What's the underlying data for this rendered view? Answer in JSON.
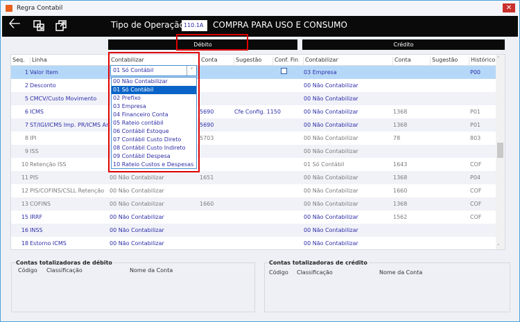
{
  "window": {
    "title": "Regra Contabil",
    "close": "✕"
  },
  "toolbar": {
    "tipo_label": "Tipo de Operação",
    "tipo_value": "110.1A",
    "tipo_desc": "COMPRA PARA USO E CONSUMO"
  },
  "bands": {
    "debito": "Débito",
    "credito": "Crédito"
  },
  "headers": {
    "seq": "Seq.",
    "linha": "Linha",
    "d_contabilizar": "Contabilizar",
    "d_conta": "Conta",
    "d_sugestao": "Sugestão",
    "conf_fin": "Conf. Fin",
    "c_contabilizar": "Contabilizar",
    "c_conta": "Conta",
    "c_sugestao": "Sugestão",
    "historico": "Histórico"
  },
  "rows": [
    {
      "seq": "1",
      "linha": "Valor Item",
      "dc": "",
      "dconta": "",
      "dsug": "",
      "cc": "03 Empresa",
      "cconta": "",
      "csug": "",
      "hist": "P00",
      "color": "blue"
    },
    {
      "seq": "2",
      "linha": "Desconto",
      "dc": "",
      "dconta": "",
      "dsug": "",
      "cc": "00 Não Contabilizar",
      "cconta": "",
      "csug": "",
      "hist": "",
      "color": "blue"
    },
    {
      "seq": "5",
      "linha": "CMCV/Custo Movimento",
      "dc": "",
      "dconta": "",
      "dsug": "",
      "cc": "00 Não Contabilizar",
      "cconta": "",
      "csug": "",
      "hist": "",
      "color": "blue"
    },
    {
      "seq": "6",
      "linha": "ICMS",
      "dc": "",
      "dconta": "5690",
      "dsug": "Cfe Config. 1150",
      "cc": "00 Não Contabilizar",
      "cconta": "1368",
      "csug": "",
      "hist": "P01",
      "color": "blue"
    },
    {
      "seq": "7",
      "linha": "ST/IGI/ICMS Imp. PR/ICMS Ar",
      "dc": "",
      "dconta": "5690",
      "dsug": "",
      "cc": "00 Não Contabilizar",
      "cconta": "1368",
      "csug": "",
      "hist": "P01",
      "color": "blue"
    },
    {
      "seq": "8",
      "linha": "IPI",
      "dc": "",
      "dconta": "5703",
      "dsug": "",
      "cc": "00 Não Contabilizar",
      "cconta": "78",
      "csug": "",
      "hist": "803",
      "color": "gray"
    },
    {
      "seq": "9",
      "linha": "ISS",
      "dc": "",
      "dconta": "",
      "dsug": "",
      "cc": "00 Não Contabilizar",
      "cconta": "",
      "csug": "",
      "hist": "",
      "color": "gray"
    },
    {
      "seq": "10",
      "linha": "Retenção ISS",
      "dc": "",
      "dconta": "",
      "dsug": "",
      "cc": "01 Só Contábil",
      "cconta": "1643",
      "csug": "",
      "hist": "COF",
      "color": "gray"
    },
    {
      "seq": "11",
      "linha": "PIS",
      "dc": "00 Não Contabilizar",
      "dconta": "1651",
      "dsug": "",
      "cc": "00 Não Contabilizar",
      "cconta": "1368",
      "csug": "",
      "hist": "P04",
      "color": "gray"
    },
    {
      "seq": "12",
      "linha": "PIS/COFINS/CSLL Retenção",
      "dc": "00 Não Contabilizar",
      "dconta": "",
      "dsug": "",
      "cc": "00 Não Contabilizar",
      "cconta": "1660",
      "csug": "",
      "hist": "COF",
      "color": "gray"
    },
    {
      "seq": "13",
      "linha": "COFINS",
      "dc": "00 Não Contabilizar",
      "dconta": "1660",
      "dsug": "",
      "cc": "00 Não Contabilizar",
      "cconta": "1368",
      "csug": "",
      "hist": "COF",
      "color": "gray"
    },
    {
      "seq": "15",
      "linha": "IRRF",
      "dc": "00 Não Contabilizar",
      "dconta": "",
      "dsug": "",
      "cc": "00 Não Contabilizar",
      "cconta": "1562",
      "csug": "",
      "hist": "COF",
      "color": "blue"
    },
    {
      "seq": "16",
      "linha": "INSS",
      "dc": "00 Não Contabilizar",
      "dconta": "",
      "dsug": "",
      "cc": "00 Não Contabilizar",
      "cconta": "",
      "csug": "",
      "hist": "",
      "color": "blue"
    },
    {
      "seq": "18",
      "linha": "Estorno ICMS",
      "dc": "00 Não Contabilizar",
      "dconta": "",
      "dsug": "",
      "cc": "00 Não Contabilizar",
      "cconta": "",
      "csug": "",
      "hist": "",
      "color": "blue"
    }
  ],
  "combo": {
    "value": "01 Só Contábil",
    "options": [
      "00 Não Contabilizar",
      "01 Só Contábil",
      "02 Prefixo",
      "03 Empresa",
      "04 Financeiro Conta",
      "05 Rateio contábil",
      "06 Contábil Estoque",
      "07 Contábil Custo Direto",
      "08 Contábil Custo Indireto",
      "09 Contábil Despesa",
      "10 Rateio Custos e Despesas"
    ],
    "selected_index": 1
  },
  "panels": {
    "debito": {
      "title": "Contas totalizadoras de débito",
      "codigo": "Código",
      "classificacao": "Classificação",
      "nome": "Nome da Conta"
    },
    "credito": {
      "title": "Contas totalizadoras de crédito",
      "codigo": "Código",
      "classificacao": "Classificação",
      "nome": "Nome da Conta"
    }
  }
}
